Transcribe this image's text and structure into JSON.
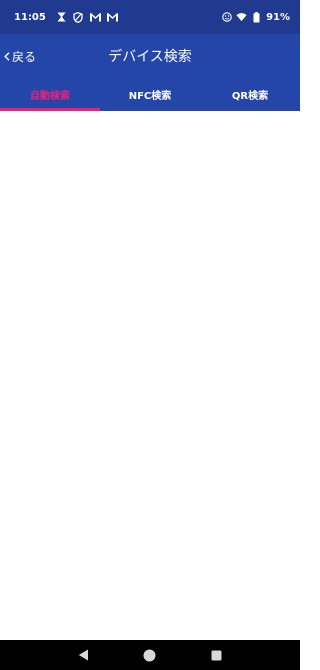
{
  "status_bar": {
    "time": "11:05",
    "battery": "91%",
    "icons_left": [
      "hourglass-icon",
      "shield-icon",
      "gmail-icon",
      "gmail-icon"
    ],
    "icons_right": [
      "smiley-icon",
      "wifi-icon",
      "battery-icon"
    ]
  },
  "app_bar": {
    "back_label": "戻る",
    "title": "デバイス検索"
  },
  "tabs": [
    {
      "label": "自動検索",
      "active": true
    },
    {
      "label": "NFC検索",
      "active": false
    },
    {
      "label": "QR検索",
      "active": false
    }
  ],
  "colors": {
    "status_bar_bg": "#1f3a8e",
    "app_bar_bg": "#2346a8",
    "accent": "#e8217c",
    "nav_bar_bg": "#000000"
  },
  "nav_bar": {
    "buttons": [
      "back-triangle-icon",
      "home-circle-icon",
      "recents-square-icon"
    ]
  }
}
